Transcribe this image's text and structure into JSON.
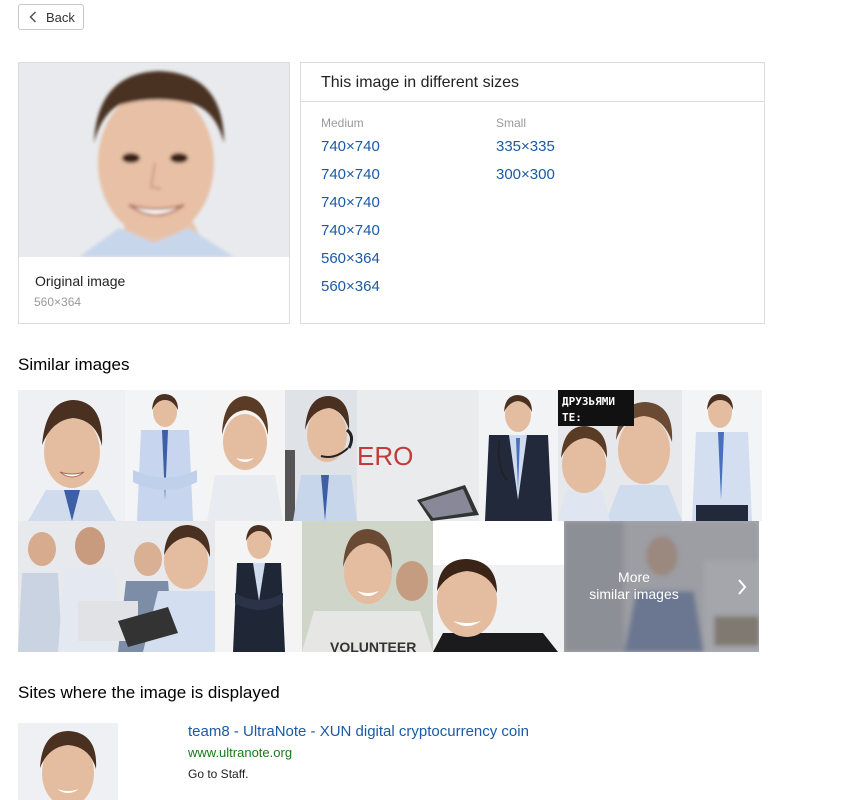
{
  "back_button": {
    "label": "Back",
    "icon": "chevron-left-icon"
  },
  "original": {
    "label": "Original image",
    "size": "560×364"
  },
  "sizes": {
    "title": "This image in different sizes",
    "medium": {
      "title": "Medium",
      "items": [
        "740×740",
        "740×740",
        "740×740",
        "740×740",
        "560×364",
        "560×364"
      ]
    },
    "small": {
      "title": "Small",
      "items": [
        "335×335",
        "300×300"
      ]
    }
  },
  "similar": {
    "title": "Similar images",
    "tile_texts": {
      "ero": "ERO",
      "russian_line1": "ДРУЗЬЯМИ",
      "russian_line2": "ТЕ:",
      "volunteer": "VOLUNTEER"
    },
    "more_line1": "More",
    "more_line2": "similar images",
    "more_icon": "chevron-right-icon"
  },
  "sites": {
    "title": "Sites where the image is displayed",
    "items": [
      {
        "title": "team8 - UltraNote - XUN digital cryptocurrency coin",
        "url": "www.ultranote.org",
        "description": "Go to Staff."
      }
    ]
  },
  "colors": {
    "link": "#1a5aa6",
    "url_green": "#1a7a1a",
    "border": "#dcdcdc",
    "muted": "#999999"
  }
}
